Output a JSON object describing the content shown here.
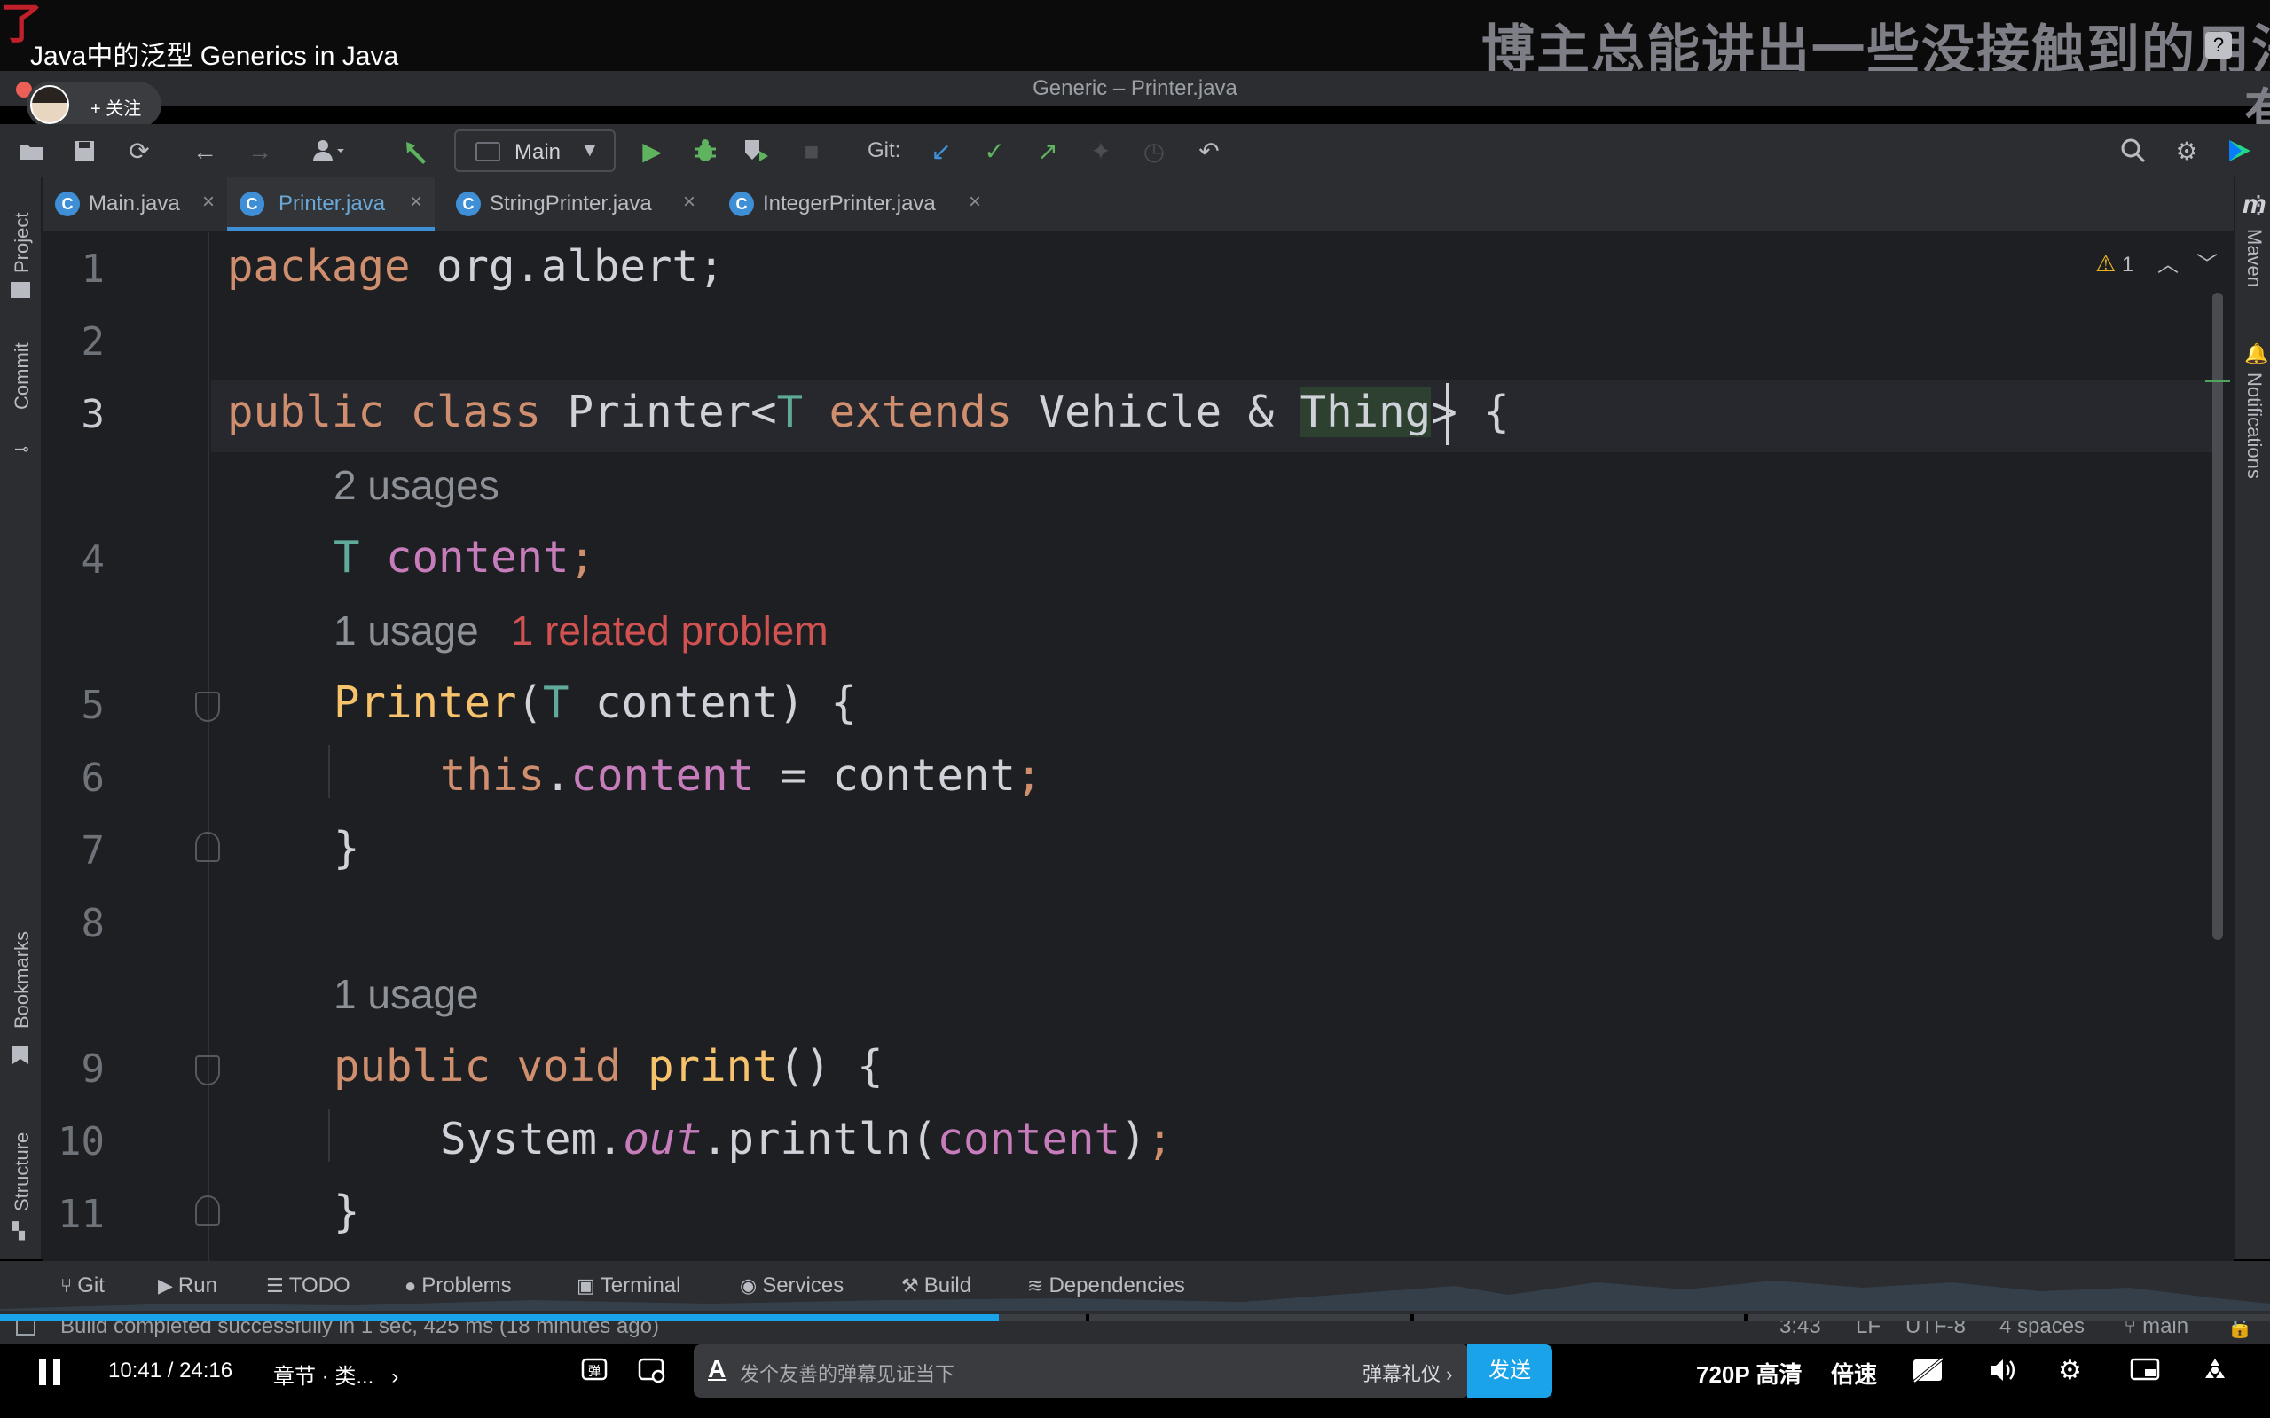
{
  "video": {
    "title": "Java中的泛型 Generics in Java",
    "danmaku_top": "博主总能讲出一些没接触到的用法",
    "danmaku_top2": "有",
    "corner_mark": "了"
  },
  "ide": {
    "window_title": "Generic – Printer.java",
    "follow_label": "+ 关注",
    "toolbar": {
      "run_config": "Main",
      "git_label": "Git:"
    },
    "tabs": [
      {
        "label": "Main.java",
        "icon": "C"
      },
      {
        "label": "Printer.java",
        "icon": "C"
      },
      {
        "label": "StringPrinter.java",
        "icon": "C"
      },
      {
        "label": "IntegerPrinter.java",
        "icon": "C"
      }
    ],
    "left_panels": [
      "Project",
      "Commit",
      "Bookmarks",
      "Structure"
    ],
    "right_panels": [
      "Maven",
      "Notifications"
    ],
    "maven_letter": "m",
    "warnings_count": "1",
    "line_numbers": [
      "1",
      "2",
      "3",
      "4",
      "5",
      "6",
      "7",
      "8",
      "9",
      "10",
      "11"
    ],
    "inlays": {
      "usages_2": "2 usages",
      "usage_1": "1 usage",
      "related_problem": "1 related problem",
      "usage_1b": "1 usage"
    },
    "code": {
      "l1_kw": "package",
      "l1_rest": " org.albert;",
      "l3_kw1": "public",
      "l3_kw2": "class",
      "l3_name": "Printer<",
      "l3_T": "T",
      "l3_ext": "extends",
      "l3_vehicle": "Vehicle &",
      "l3_thing": "Thing",
      "l3_end": "> {",
      "l4_T": "T",
      "l4_field": "content",
      "l4_semi": ";",
      "l5_ctor": "Printer",
      "l5_open": "(",
      "l5_T": "T",
      "l5_rest": " content) {",
      "l6_this": "this",
      "l6_dot": ".",
      "l6_field": "content",
      "l6_rest": " = content",
      "l6_semi": ";",
      "l7": "}",
      "l9_kw1": "public",
      "l9_kw2": "void",
      "l9_fn": "print",
      "l9_rest": "() {",
      "l10_sys": "System.",
      "l10_out": "out",
      "l10_mid": ".println(",
      "l10_field": "content",
      "l10_end": ")",
      "l10_semi": ";",
      "l11": "}"
    },
    "bottom_tools": [
      "Git",
      "Run",
      "TODO",
      "Problems",
      "Terminal",
      "Services",
      "Build",
      "Dependencies"
    ],
    "status": {
      "message": "Build completed successfully in 1 sec, 425 ms (18 minutes ago)",
      "position": "3:43",
      "line_sep": "LF",
      "encoding": "UTF-8",
      "indent": "4 spaces",
      "branch": "main"
    }
  },
  "player": {
    "time": "10:41 / 24:16",
    "chapter": "章节 · 类...",
    "danmaku_placeholder": "发个友善的弹幕见证当下",
    "danmaku_etiquette": "弹幕礼仪 ›",
    "send": "发送",
    "quality": "720P 高清",
    "speed": "倍速",
    "progress": 0.44
  },
  "colors": {
    "keyword": "#cf8e6d",
    "type_param": "#5faa9a",
    "field": "#c77dbb",
    "method": "#f6c26b",
    "error": "#d25252",
    "accent": "#3f8fd6",
    "send_button": "#1aa3e8"
  }
}
